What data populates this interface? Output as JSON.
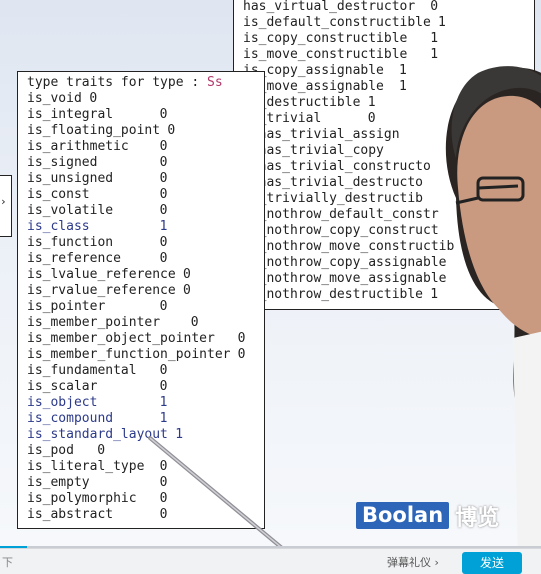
{
  "left_panel": {
    "header_prefix": "type traits for type : ",
    "header_type": "Ss",
    "rows": [
      {
        "name": "is_void",
        "value": "0"
      },
      {
        "name": "is_integral",
        "value": "0"
      },
      {
        "name": "is_floating_point",
        "value": "0"
      },
      {
        "name": "is_arithmetic",
        "value": "0"
      },
      {
        "name": "is_signed",
        "value": "0"
      },
      {
        "name": "is_unsigned",
        "value": "0"
      },
      {
        "name": "is_const",
        "value": "0"
      },
      {
        "name": "is_volatile",
        "value": "0"
      },
      {
        "name": "is_class",
        "value": "1"
      },
      {
        "name": "is_function",
        "value": "0"
      },
      {
        "name": "is_reference",
        "value": "0"
      },
      {
        "name": "is_lvalue_reference",
        "value": "0"
      },
      {
        "name": "is_rvalue_reference",
        "value": "0"
      },
      {
        "name": "is_pointer",
        "value": "0"
      },
      {
        "name": "is_member_pointer",
        "value": "0"
      },
      {
        "name": "is_member_object_pointer",
        "value": "0"
      },
      {
        "name": "is_member_function_pointer",
        "value": "0"
      },
      {
        "name": "is_fundamental",
        "value": "0"
      },
      {
        "name": "is_scalar",
        "value": "0"
      },
      {
        "name": "is_object",
        "value": "1"
      },
      {
        "name": "is_compound",
        "value": "1"
      },
      {
        "name": "is_standard_layout",
        "value": "1"
      },
      {
        "name": "is_pod",
        "value": "0"
      },
      {
        "name": "is_literal_type",
        "value": "0"
      },
      {
        "name": "is_empty",
        "value": "0"
      },
      {
        "name": "is_polymorphic",
        "value": "0"
      },
      {
        "name": "is_abstract",
        "value": "0"
      }
    ]
  },
  "right_panel": {
    "rows": [
      {
        "name": "has_virtual_destructor",
        "value": "0"
      },
      {
        "name": "is_default_constructible",
        "value": "1"
      },
      {
        "name": "is_copy_constructible",
        "value": "1"
      },
      {
        "name": "is_move_constructible",
        "value": "1"
      },
      {
        "name": "is_copy_assignable",
        "value": "1"
      },
      {
        "name": "is_move_assignable",
        "value": "1"
      },
      {
        "name": "is_destructible",
        "value": "1"
      },
      {
        "name": "is_trivial",
        "value": "0"
      },
      {
        "name": "__has_trivial_assign",
        "value": ""
      },
      {
        "name": "__has_trivial_copy",
        "value": ""
      },
      {
        "name": "__has_trivial_constructo",
        "value": ""
      },
      {
        "name": "__has_trivial_destructo",
        "value": ""
      },
      {
        "name": "is_trivially_destructib",
        "value": ""
      },
      {
        "name": "is_nothrow_default_constr",
        "value": ""
      },
      {
        "name": "is_nothrow_copy_construct",
        "value": ""
      },
      {
        "name": "is_nothrow_move_constructib",
        "value": ""
      },
      {
        "name": "is_nothrow_copy_assignable",
        "value": ""
      },
      {
        "name": "is_nothrow_move_assignable",
        "value": ""
      },
      {
        "name": "is_nothrow_destructible",
        "value": "1"
      }
    ]
  },
  "logo": {
    "en": "Boolan",
    "cn": "博览"
  },
  "player": {
    "danmu_placeholder": "下",
    "etiquette_label": "弹幕礼仪 ›",
    "send_label": "发送",
    "progress_fraction": 0.05,
    "accent": "#00a1d6"
  },
  "icons": {
    "edge_arrow": "chevron-right-icon"
  }
}
